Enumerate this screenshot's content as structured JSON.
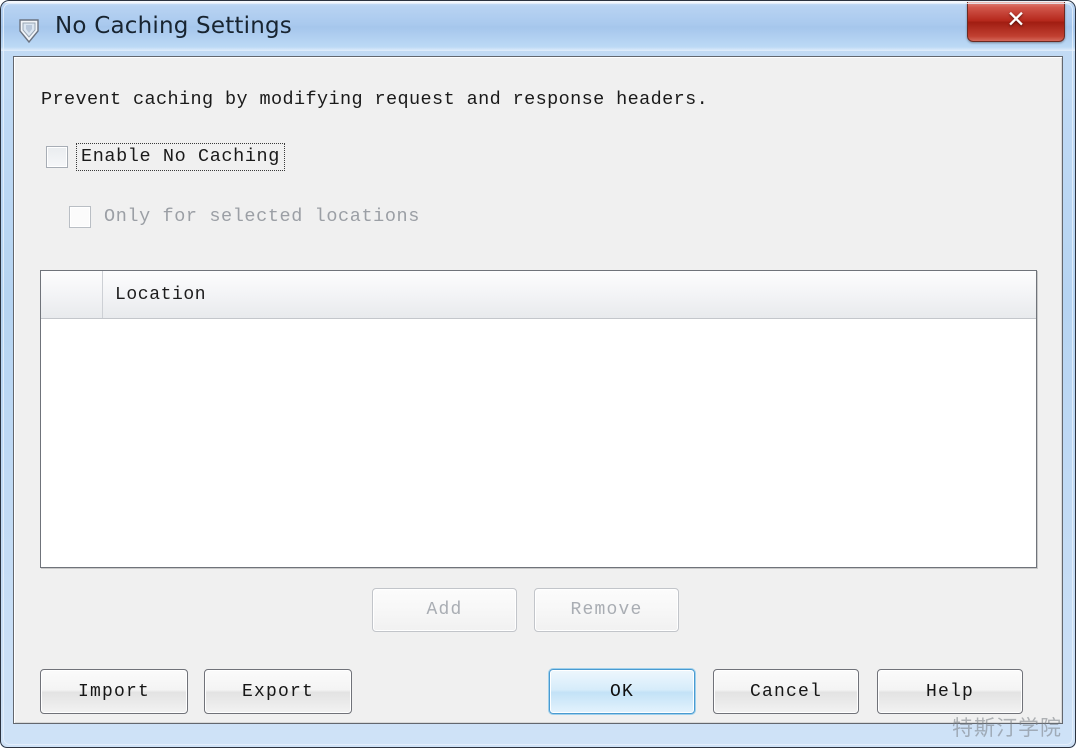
{
  "window": {
    "title": "No Caching Settings",
    "app_icon": "app-shield-icon",
    "close_label": "✕",
    "accent_blue": "#a9c9ee",
    "close_red": "#b5281c",
    "default_button_blue": "#4a9bd1"
  },
  "content": {
    "description": "Prevent caching by modifying request and response headers.",
    "enable_no_caching": {
      "label": "Enable No Caching",
      "checked": false,
      "focused": true,
      "enabled": true
    },
    "only_selected_locations": {
      "label": "Only for selected locations",
      "checked": false,
      "enabled": false
    }
  },
  "table": {
    "columns": [
      "",
      "Location"
    ],
    "header_location": "Location",
    "rows": []
  },
  "list_buttons": [
    {
      "label": "Add",
      "enabled": false
    },
    {
      "label": "Remove",
      "enabled": false
    }
  ],
  "footer_buttons": {
    "import": "Import",
    "export": "Export",
    "ok": "OK",
    "cancel": "Cancel",
    "help": "Help"
  },
  "watermark": "特斯汀学院"
}
